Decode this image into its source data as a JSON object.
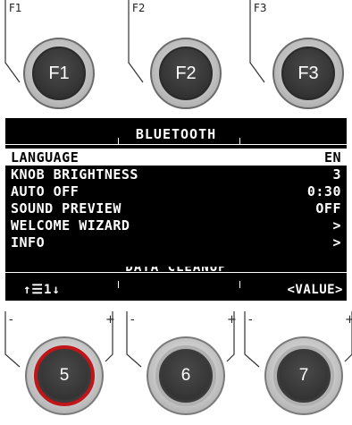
{
  "function_keys": [
    {
      "top_label": "F1",
      "button_label": "F1"
    },
    {
      "top_label": "F2",
      "button_label": "F2"
    },
    {
      "top_label": "F3",
      "button_label": "F3"
    }
  ],
  "display": {
    "title": "BLUETOOTH",
    "menu_items": [
      {
        "label": "LANGUAGE",
        "value": "EN",
        "selected": true
      },
      {
        "label": "KNOB BRIGHTNESS",
        "value": "3",
        "selected": false
      },
      {
        "label": "AUTO OFF",
        "value": "0:30",
        "selected": false
      },
      {
        "label": "SOUND PREVIEW",
        "value": "OFF",
        "selected": false
      },
      {
        "label": "WELCOME WIZARD",
        "value": ">",
        "selected": false
      },
      {
        "label": "INFO",
        "value": ">",
        "selected": false
      }
    ],
    "partial_item": "DATA CLEANUP",
    "bottom_left": "↑☰1↓",
    "bottom_right": "<VALUE>"
  },
  "knobs": [
    {
      "label": "5",
      "minus": "-",
      "plus": "+",
      "ring_color": "#c0161a"
    },
    {
      "label": "6",
      "minus": "-",
      "plus": "+",
      "ring_color": "#b0b0b0"
    },
    {
      "label": "7",
      "minus": "-",
      "plus": "+",
      "ring_color": "#b0b0b0"
    }
  ]
}
